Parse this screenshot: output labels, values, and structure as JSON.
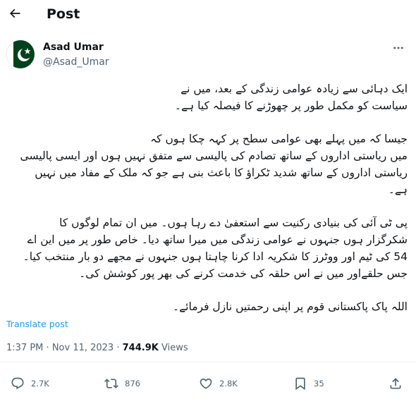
{
  "header": {
    "title": "Post",
    "back_icon": "arrow-left-icon"
  },
  "author": {
    "name": "Asad Umar",
    "handle": "@Asad_Umar",
    "avatar": "pakistan-flag-avatar"
  },
  "post": {
    "paragraphs": [
      [
        "ایک دہائی سے زیادہ عوامی زندگی کے بعد، میں نے",
        "سیاست کو مکمل طور پر چھوڑنے کا فیصلہ کیا ہے۔"
      ],
      [
        "جیسا کہ میں پہلے بھی عوامی سطح پر کہہ چکا ہوں کہ",
        "میں ریاستی اداروں کے ساتھ تصادم کی پالیسی سے متفق نہیں ہوں اور ایسی پالیسی",
        "ریاستی اداروں کے ساتھ شدید ٹکراؤ کا باعث بنی ہے جو کہ ملک کے مفاد میں نہیں",
        "ہے۔"
      ],
      [
        "پی ٹی آئی کی بنیادی رکنیت سے استعفیٰ دے رہا ہوں۔ میں ان تمام لوگوں کا",
        "شکرگزار ہوں جنہوں نے عوامی زندگی میں میرا ساتھ دیا۔ خاص طور پر میں این اے",
        "54 کی ٹیم اور ووٹرز کا شکریہ ادا کرنا چاہتا ہوں جنہوں نے مجھے دو بار منتخب کیا۔",
        "جس حلقےاور میں نے اس حلقہ کی خدمت کرنے کی بھر پور کوشش کی۔"
      ],
      [
        "اللہ پاک پاکستانی قوم پر اپنی رحمتیں نازل فرمائے۔"
      ]
    ],
    "translate_label": "Translate post"
  },
  "meta": {
    "time": "1:37 PM",
    "separator": "·",
    "date": "Nov 11, 2023",
    "views_count": "744.9K",
    "views_label": "Views"
  },
  "actions": {
    "reply": {
      "count": "2.7K",
      "icon": "reply-icon"
    },
    "repost": {
      "count": "876",
      "icon": "repost-icon"
    },
    "like": {
      "count": "2.8K",
      "icon": "heart-icon"
    },
    "bookmark": {
      "count": "35",
      "icon": "bookmark-icon"
    },
    "share": {
      "icon": "share-icon"
    }
  },
  "colors": {
    "link": "#1d9bf0",
    "secondary_text": "#536471",
    "primary_text": "#0f1419",
    "flag_green": "#01411c"
  }
}
